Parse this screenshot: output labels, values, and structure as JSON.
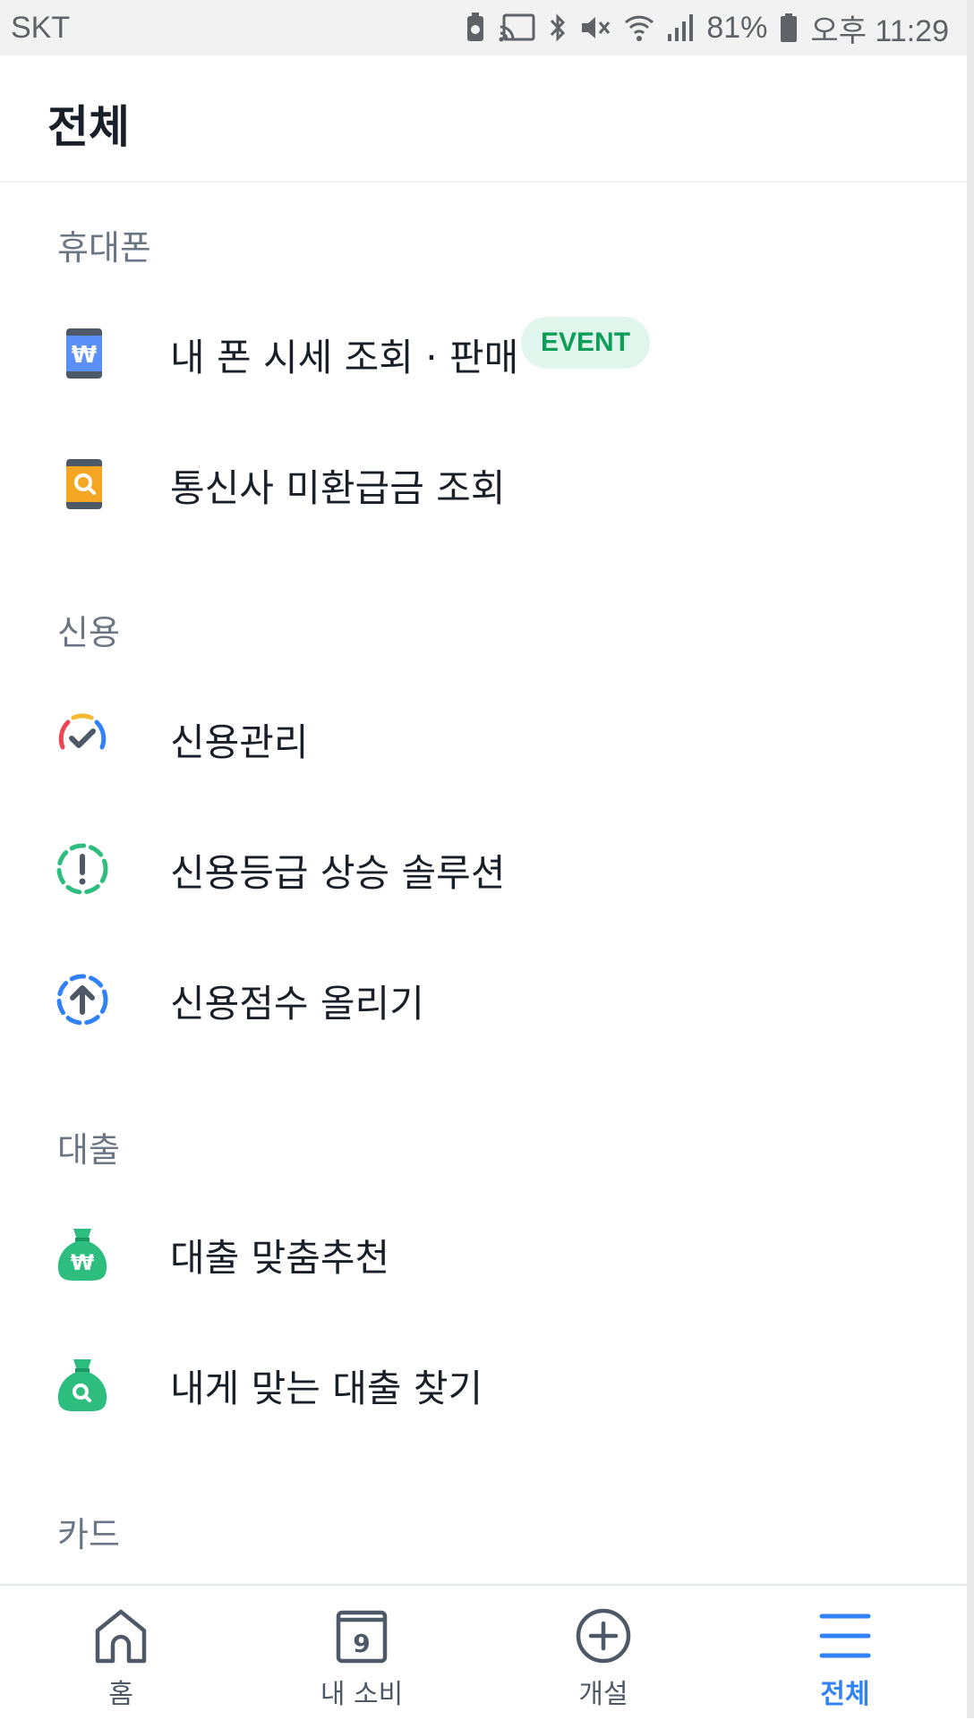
{
  "status_bar": {
    "carrier": "SKT",
    "battery_percent": "81%",
    "time": "오후 11:29",
    "icons": [
      "battery-saver-icon",
      "cast-icon",
      "bluetooth-icon",
      "mute-icon",
      "wifi-icon",
      "signal-icon",
      "battery-icon"
    ]
  },
  "header": {
    "title": "전체"
  },
  "sections": {
    "phone": {
      "title": "휴대폰",
      "items": [
        {
          "label": "내 폰 시세 조회 · 판매",
          "badge": "EVENT",
          "icon": "phone-won-icon"
        },
        {
          "label": "통신사 미환급금 조회",
          "icon": "phone-search-icon"
        }
      ]
    },
    "credit": {
      "title": "신용",
      "items": [
        {
          "label": "신용관리",
          "icon": "credit-check-icon"
        },
        {
          "label": "신용등급 상승 솔루션",
          "icon": "credit-alert-icon"
        },
        {
          "label": "신용점수 올리기",
          "icon": "credit-up-icon"
        }
      ]
    },
    "loan": {
      "title": "대출",
      "items": [
        {
          "label": "대출 맞춤추천",
          "icon": "money-bag-won-icon"
        },
        {
          "label": "내게 맞는 대출 찾기",
          "icon": "money-bag-search-icon"
        }
      ]
    },
    "card": {
      "title": "카드"
    }
  },
  "tabbar": {
    "tabs": [
      {
        "label": "홈",
        "icon": "home-icon"
      },
      {
        "label": "내 소비",
        "icon": "calendar-icon",
        "calendar_day": "9"
      },
      {
        "label": "개설",
        "icon": "plus-circle-icon"
      },
      {
        "label": "전체",
        "icon": "menu-icon",
        "active": true
      }
    ]
  },
  "colors": {
    "accent": "#3182f6",
    "badge_bg": "#e0f5ec",
    "badge_text": "#0f9d58",
    "green_icon": "#2dbd7e",
    "phone_blue": "#5b8ff9",
    "phone_orange": "#f5a623"
  }
}
